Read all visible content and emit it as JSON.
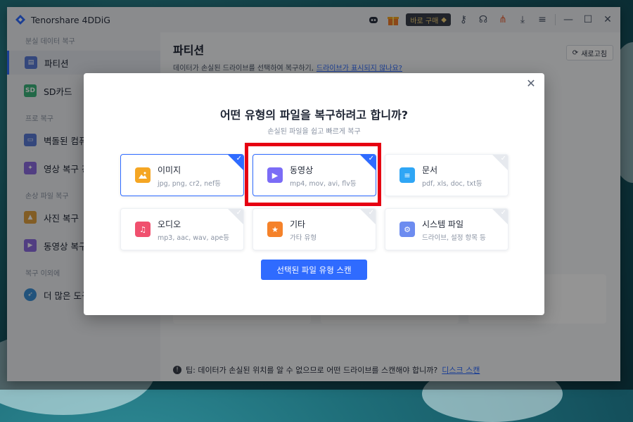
{
  "app": {
    "title": "Tenorshare 4DDiG",
    "buy_label": "바로 구매"
  },
  "sidebar": {
    "sections": [
      {
        "label": "분실 데이터 복구"
      },
      {
        "label": "프로 복구"
      },
      {
        "label": "손상 파일 복구"
      },
      {
        "label": "복구 이외에"
      }
    ],
    "items": [
      {
        "label": "파티션",
        "icon": "partition-icon"
      },
      {
        "label": "SD카드",
        "icon": "sd-card-icon"
      },
      {
        "label": "벽돌된 컴퓨",
        "icon": "computer-icon"
      },
      {
        "label": "영상 복구 강",
        "icon": "video-repair-icon"
      },
      {
        "label": "사진 복구",
        "icon": "photo-icon"
      },
      {
        "label": "동영상 복구",
        "icon": "video-icon"
      },
      {
        "label": "더 많은 도구",
        "icon": "compass-icon"
      }
    ]
  },
  "main": {
    "title": "파티션",
    "subtitle": "데이터가 손실된 드라이브를 선택하여 복구하기,",
    "subtitle_link": "드라이브가 표시되지 않나요?",
    "refresh_label": "새로고침",
    "tip_text": "팁: 데이터가 손실된 위치를 알 수 없으므로 어떤 드라이브를 스캔해야 합니까?",
    "tip_link": "디스크 스캔"
  },
  "modal": {
    "title": "어떤 유형의 파일을 복구하려고 합니까?",
    "subtitle": "손실된 파일을 쉽고 빠르게 복구",
    "scan_button": "선택된 파일 유형 스캔",
    "file_types": [
      {
        "name": "이미지",
        "desc": "jpg, png, cr2, nef등",
        "icon": "image-icon",
        "color": "#f5a623",
        "selected": true
      },
      {
        "name": "동영상",
        "desc": "mp4, mov, avi, flv등",
        "icon": "video-play-icon",
        "color": "#7b6cf6",
        "selected": true
      },
      {
        "name": "문서",
        "desc": "pdf, xls, doc, txt등",
        "icon": "document-icon",
        "color": "#2fa6f5",
        "selected": false
      },
      {
        "name": "오디오",
        "desc": "mp3, aac, wav, ape등",
        "icon": "audio-icon",
        "color": "#f0506e",
        "selected": false
      },
      {
        "name": "기타",
        "desc": "가타 유형",
        "icon": "other-icon",
        "color": "#f5822a",
        "selected": false
      },
      {
        "name": "시스템 파일",
        "desc": "드라이브, 설정 항목 등",
        "icon": "system-file-icon",
        "color": "#6d8cf0",
        "selected": false
      }
    ]
  },
  "colors": {
    "accent": "#2f6bff",
    "highlight": "#e60012"
  }
}
